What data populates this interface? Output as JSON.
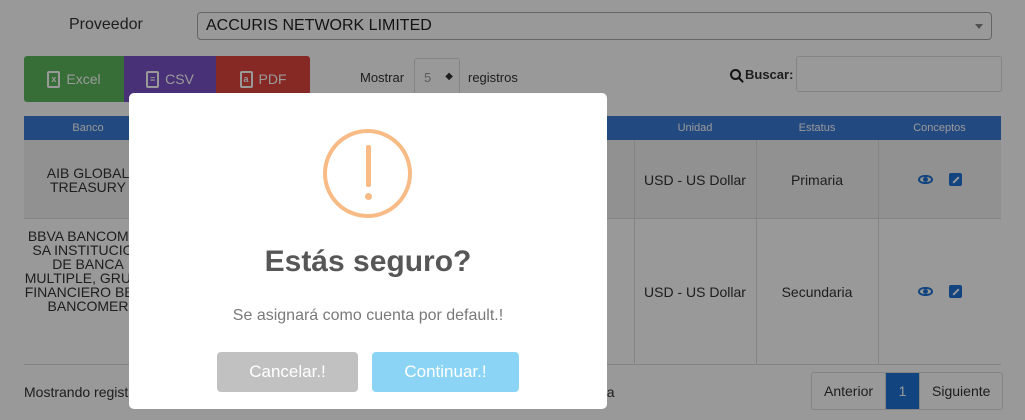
{
  "filter": {
    "label": "Proveedor",
    "value": "ACCURIS NETWORK LIMITED"
  },
  "export": {
    "excel": "Excel",
    "csv": "CSV",
    "pdf": "PDF"
  },
  "length": {
    "label_before": "Mostrar",
    "value": "5",
    "label_after": "registros"
  },
  "search": {
    "label": "Buscar:",
    "value": ""
  },
  "table": {
    "headers": {
      "banco": "Banco",
      "unidad": "Unidad",
      "estatus": "Estatus",
      "conceptos": "Conceptos"
    },
    "rows": [
      {
        "banco": "AIB GLOBAL TREASURY",
        "unidad": "USD - US Dollar",
        "estatus": "Primaria"
      },
      {
        "banco": "BBVA BANCOMER SA INSTITUCION DE BANCA MULTIPLE, GRUPO FINANCIERO BBVA BANCOMER",
        "unidad": "USD - US Dollar",
        "estatus": "Secundaria"
      }
    ]
  },
  "footer": {
    "info": "Mostrando regist",
    "trail": "rla"
  },
  "pagination": {
    "prev": "Anterior",
    "current": "1",
    "next": "Siguiente"
  },
  "modal": {
    "icon": "warning-exclamation-icon",
    "title": "Estás seguro?",
    "text": "Se asignará como cuenta por default.!",
    "cancel": "Cancelar.!",
    "confirm": "Continuar.!"
  },
  "colors": {
    "warning": "#f8bb86",
    "confirm": "#8cd4f5",
    "cancel": "#c1c1c1",
    "header": "#3a7bd5",
    "link": "#1f73d6"
  }
}
